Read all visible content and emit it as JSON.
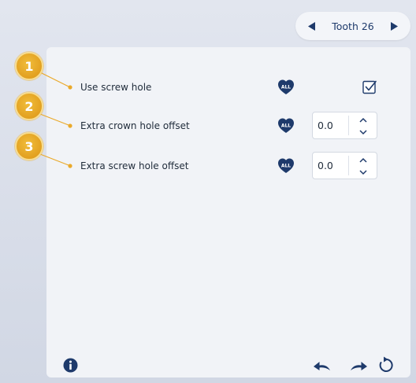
{
  "tooth_selector": {
    "label": "Tooth 26",
    "prev_icon": "triangle-left-icon",
    "next_icon": "triangle-right-icon"
  },
  "callouts": [
    "1",
    "2",
    "3"
  ],
  "rows": [
    {
      "label": "Use screw hole",
      "all_badge": "ALL",
      "control": "checkbox",
      "checked": true
    },
    {
      "label": "Extra crown hole offset",
      "all_badge": "ALL",
      "control": "number",
      "value": "0.0"
    },
    {
      "label": "Extra screw hole offset",
      "all_badge": "ALL",
      "control": "number",
      "value": "0.0"
    }
  ],
  "footer": {
    "icons": [
      "info-icon",
      "undo-icon",
      "redo-icon",
      "reset-icon"
    ]
  },
  "colors": {
    "accent_navy": "#1e3a6b",
    "callout_gold": "#e2a020",
    "panel_bg": "#f1f3f7"
  }
}
